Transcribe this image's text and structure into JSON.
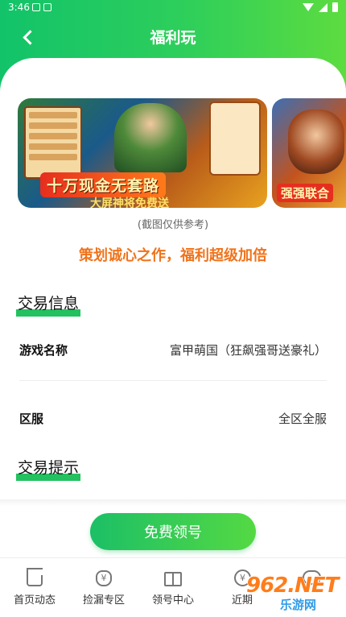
{
  "status_bar": {
    "time": "3:46"
  },
  "header": {
    "title": "福利玩"
  },
  "banner": {
    "headline": "十万现金无套路",
    "subline": "大屏神将免费送",
    "secondary_headline": "强强联合",
    "caption": "(截图仅供参考)"
  },
  "slogan": "策划诚心之作，福利超级加倍",
  "trade_info": {
    "title": "交易信息",
    "rows": [
      {
        "label": "游戏名称",
        "value": "富甲萌国（狂飙强哥送豪礼）"
      },
      {
        "label": "区服",
        "value": "全区全服"
      }
    ]
  },
  "trade_tips": {
    "title": "交易提示"
  },
  "claim_button": {
    "label": "免费领号"
  },
  "tabbar": {
    "items": [
      {
        "label": "首页动态",
        "icon": "home-icon"
      },
      {
        "label": "捡漏专区",
        "icon": "money-bag-icon"
      },
      {
        "label": "领号中心",
        "icon": "gift-icon"
      },
      {
        "label": "近期",
        "icon": "coin-icon"
      },
      {
        "label": "",
        "icon": "chat-icon"
      }
    ]
  },
  "watermark": {
    "main": "962.NET",
    "sub": "乐游网"
  },
  "colors": {
    "brand_green": "#23c160",
    "slogan_orange": "#f0731b"
  }
}
